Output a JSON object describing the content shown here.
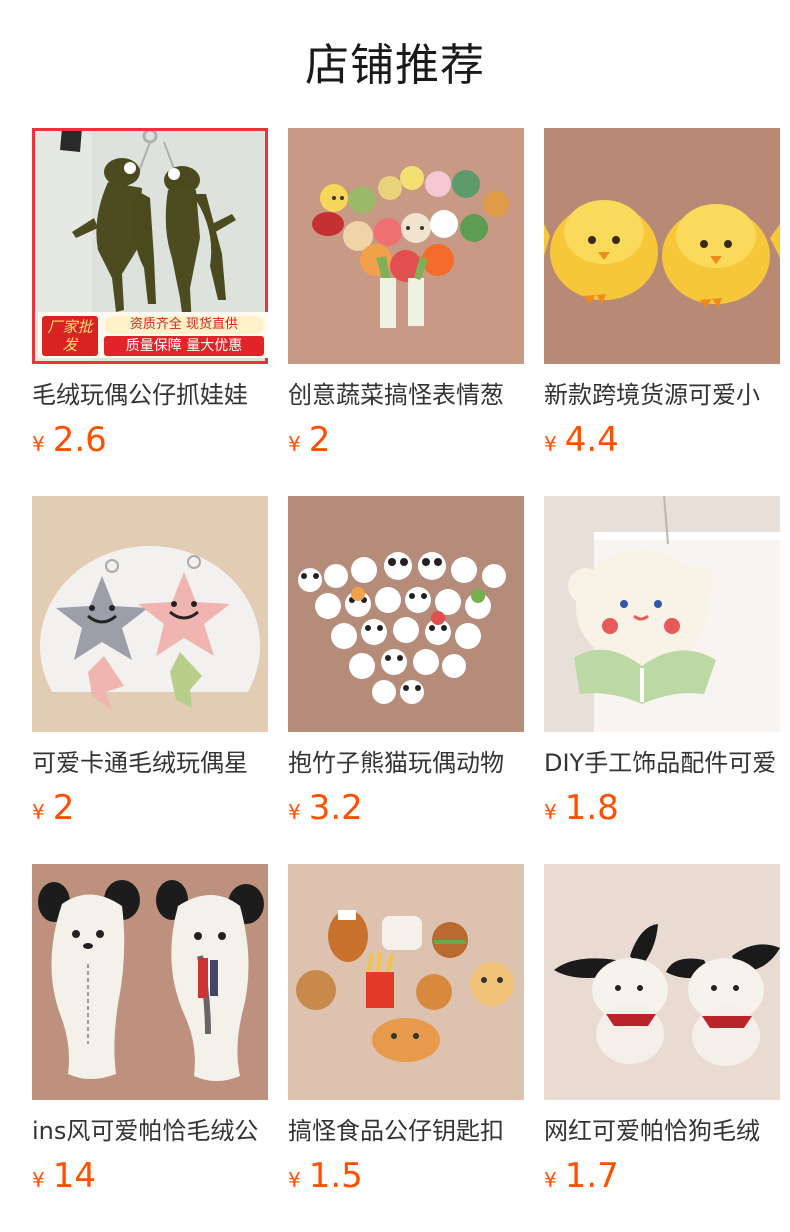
{
  "section": {
    "title": "店铺推荐"
  },
  "products": [
    {
      "name": "毛绒玩偶公仔抓娃娃",
      "currency": "¥",
      "price": "2.6",
      "image": "frog-plush-keychain",
      "bg": "#dfe3df"
    },
    {
      "name": "创意蔬菜搞怪表情葱",
      "currency": "¥",
      "price": "2",
      "image": "vegetable-plush-set",
      "bg": "#c99a85"
    },
    {
      "name": "新款跨境货源可爱小",
      "currency": "¥",
      "price": "4.4",
      "image": "yellow-chick-plush",
      "bg": "#b98a76"
    },
    {
      "name": "可爱卡通毛绒玩偶星",
      "currency": "¥",
      "price": "2",
      "image": "star-plush-keychain",
      "bg": "#e2cdb4"
    },
    {
      "name": "抱竹子熊猫玩偶动物",
      "currency": "¥",
      "price": "3.2",
      "image": "panda-plush-set",
      "bg": "#b58b79"
    },
    {
      "name": "DIY手工饰品配件可爱",
      "currency": "¥",
      "price": "1.8",
      "image": "white-dog-plush",
      "bg": "#e8e0d8"
    },
    {
      "name": "ins风可爱帕恰毛绒公",
      "currency": "¥",
      "price": "14",
      "image": "dog-pencil-case",
      "bg": "#be927f"
    },
    {
      "name": "搞怪食品公仔钥匙扣",
      "currency": "¥",
      "price": "1.5",
      "image": "food-plush-set",
      "bg": "#dec2b0"
    },
    {
      "name": "网红可爱帕恰狗毛绒",
      "currency": "¥",
      "price": "1.7",
      "image": "pochacco-plush",
      "bg": "#e9dbd2"
    }
  ],
  "promo_badge": {
    "left": "厂家批发",
    "top": "资质齐全 现货直供",
    "bottom": "质量保障 量大优惠"
  }
}
